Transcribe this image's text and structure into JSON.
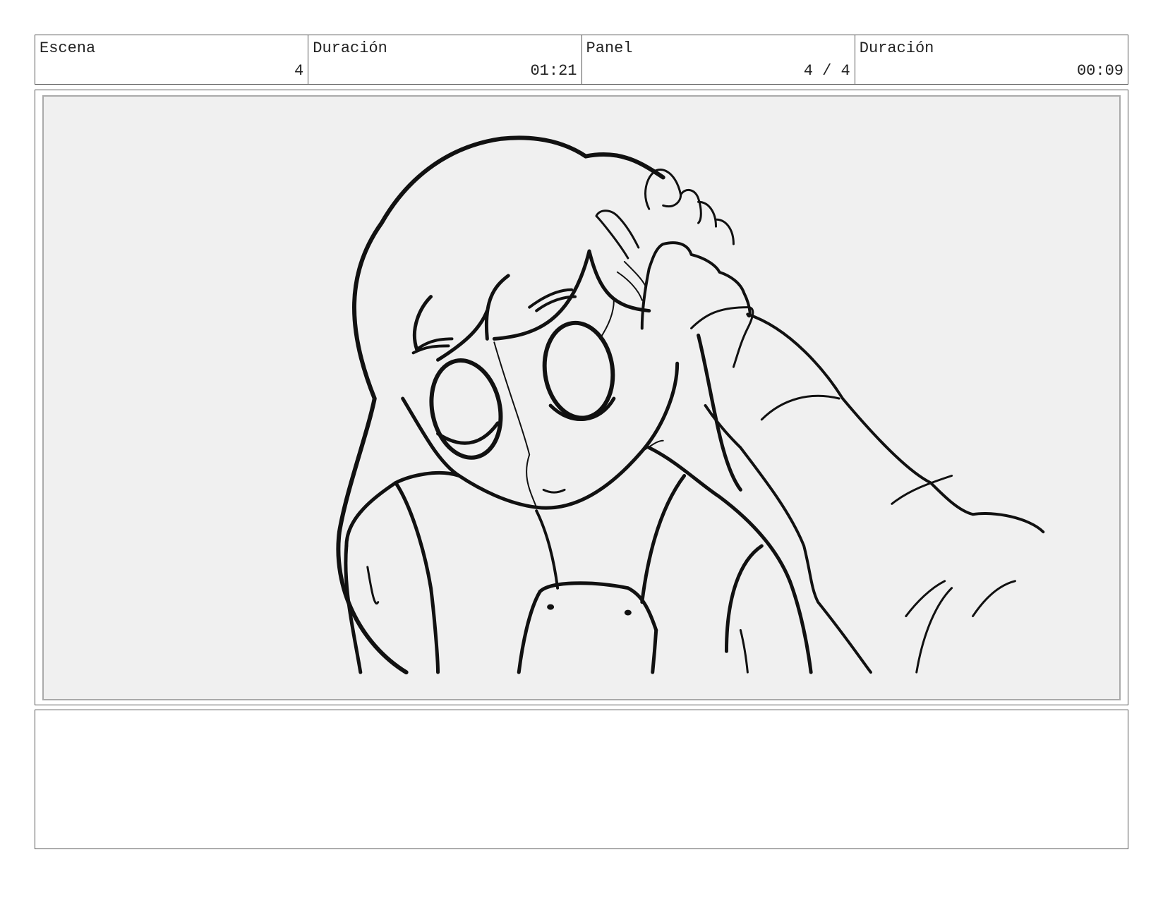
{
  "header": {
    "scene_label": "Escena",
    "scene_value": "4",
    "scene_duration_label": "Duración",
    "scene_duration_value": "01:21",
    "panel_label": "Panel",
    "panel_value": "4 / 4",
    "panel_duration_label": "Duración",
    "panel_duration_value": "00:09"
  },
  "notes": {
    "text": ""
  },
  "colors": {
    "canvas_bg": "#f0f0f0",
    "ink": "#111111",
    "border": "#555555"
  }
}
